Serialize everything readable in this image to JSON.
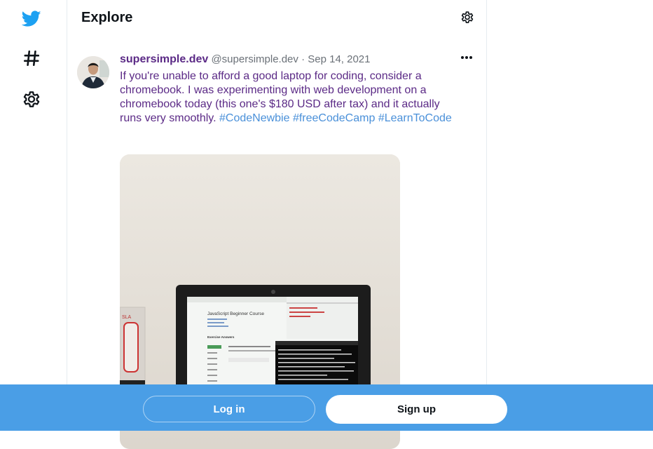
{
  "nav": {
    "items": [
      {
        "icon": "twitter-bird-icon"
      },
      {
        "icon": "hashtag-icon"
      },
      {
        "icon": "gear-icon"
      }
    ]
  },
  "header": {
    "title": "Explore",
    "settings_icon": "gear-icon"
  },
  "tweet": {
    "author_name": "supersimple.dev",
    "author_handle": "@supersimple.dev",
    "separator": "·",
    "date": "Sep 14, 2021",
    "more_icon": "more-horizontal-icon",
    "text": "If you're unable to afford a good laptop for coding, consider a chromebook. I was experimenting with web development on a chromebook today (this one's $180 USD after tax) and it actually runs very smoothly.",
    "hashtags": [
      "#CodeNewbie",
      "#freeCodeCamp",
      "#LearnToCode"
    ],
    "media": {
      "course_title": "JavaScript Beginner Course",
      "exercise_label": "Exercise Answers"
    }
  },
  "bottom_bar": {
    "login_label": "Log in",
    "signup_label": "Sign up"
  },
  "colors": {
    "brand_blue": "#1da1f2",
    "bottom_bar": "#4a9ee6",
    "name_purple": "#5b2a86",
    "hashtag_blue": "#4a90d9"
  }
}
